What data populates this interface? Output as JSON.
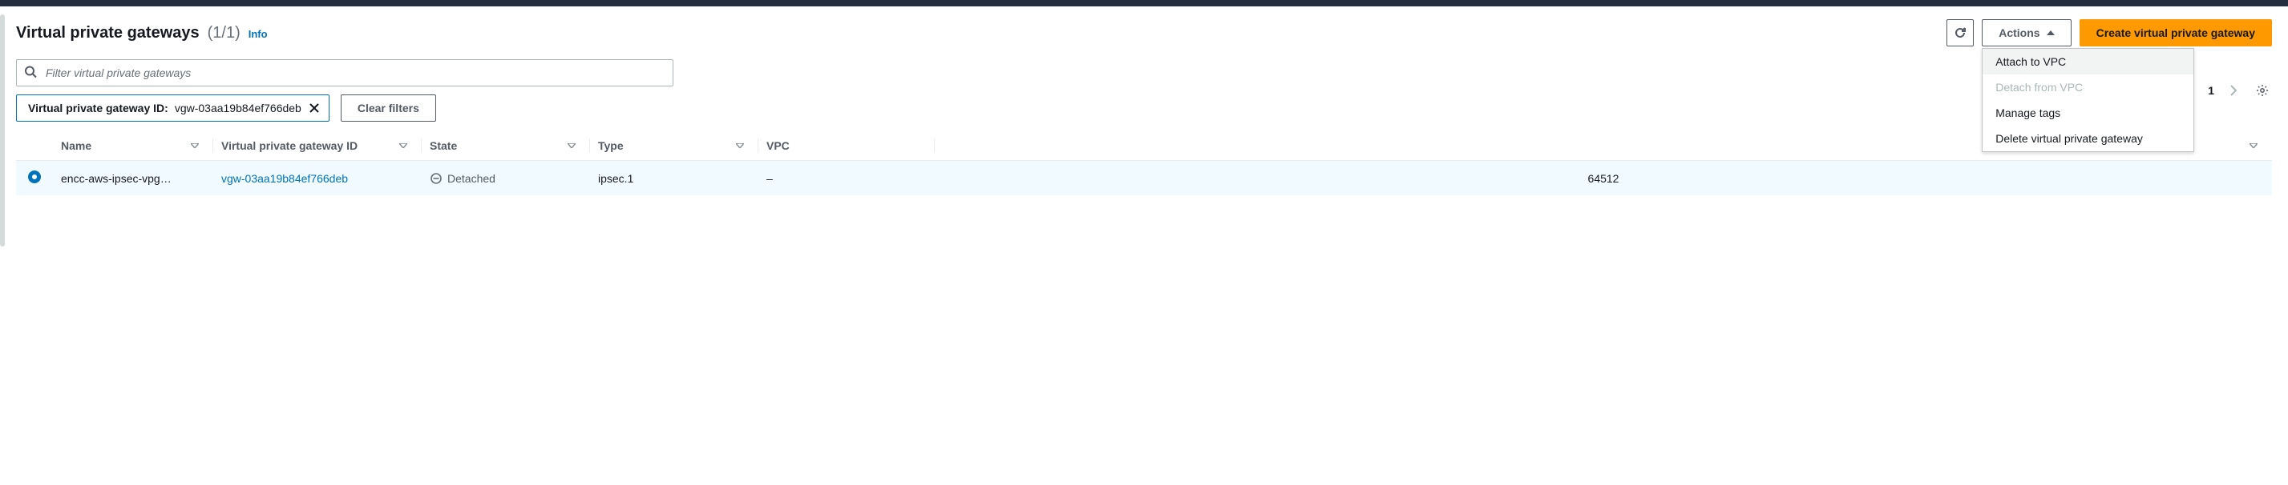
{
  "header": {
    "title": "Virtual private gateways",
    "count": "(1/1)",
    "info_label": "Info"
  },
  "toolbar": {
    "actions_label": "Actions",
    "create_label": "Create virtual private gateway"
  },
  "actions_menu": {
    "items": [
      {
        "label": "Attach to VPC",
        "disabled": false,
        "highlighted": true
      },
      {
        "label": "Detach from VPC",
        "disabled": true,
        "highlighted": false
      },
      {
        "label": "Manage tags",
        "disabled": false,
        "highlighted": false
      },
      {
        "label": "Delete virtual private gateway",
        "disabled": false,
        "highlighted": false
      }
    ]
  },
  "search": {
    "placeholder": "Filter virtual private gateways"
  },
  "filters": {
    "chip_label": "Virtual private gateway ID:",
    "chip_value": "vgw-03aa19b84ef766deb",
    "clear_label": "Clear filters"
  },
  "pagination": {
    "current": "1"
  },
  "table": {
    "columns": {
      "name": "Name",
      "vgw_id": "Virtual private gateway ID",
      "state": "State",
      "type": "Type",
      "vpc": "VPC",
      "asn": ""
    },
    "rows": [
      {
        "selected": true,
        "name": "encc-aws-ipsec-vpg…",
        "vgw_id": "vgw-03aa19b84ef766deb",
        "state": "Detached",
        "type": "ipsec.1",
        "vpc": "–",
        "asn": "64512"
      }
    ]
  }
}
